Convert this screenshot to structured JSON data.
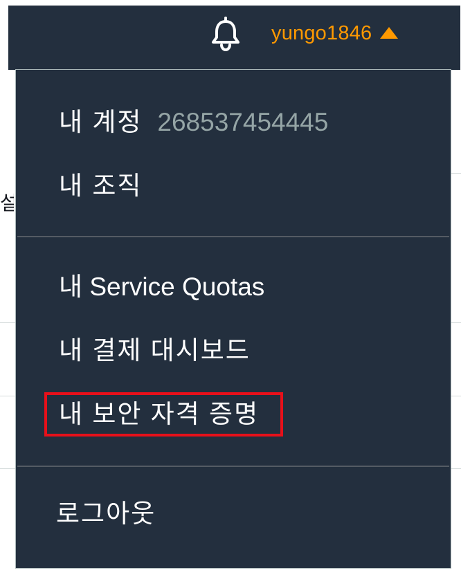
{
  "navbar": {
    "username": "yungo1846",
    "icons": {
      "notifications": "bell-icon",
      "expand": "caret-up-icon"
    },
    "colors": {
      "background": "#232f3e",
      "accent": "#ff9900"
    }
  },
  "menu": {
    "account": {
      "label": "내 계정",
      "id": "268537454445"
    },
    "items": [
      {
        "label": "내 조직"
      },
      {
        "label": "내 Service Quotas"
      },
      {
        "label": "내 결제 대시보드"
      },
      {
        "label": "내 보안 자격 증명",
        "highlighted": true
      },
      {
        "label": "로그아웃"
      }
    ],
    "colors": {
      "text": "#ffffff",
      "muted": "#95a5a6",
      "highlight_border": "#e8101a"
    }
  },
  "background": {
    "partial_glyph": "설"
  }
}
